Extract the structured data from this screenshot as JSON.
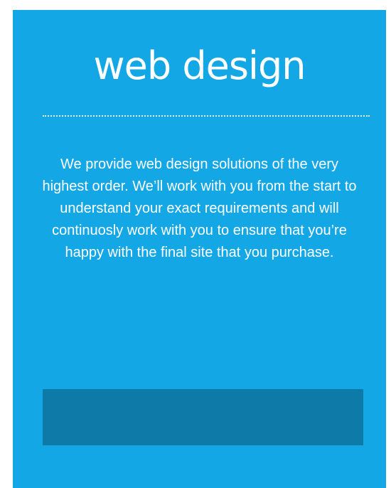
{
  "card": {
    "title": "web design",
    "description": "We provide web design solutions of the very highest order. We’ll work with you from the start to understand your exact requirements and will continuosly work with you to ensure that you’re happy with the final site that you purchase.",
    "button_label": ""
  },
  "colors": {
    "card_background": "#14a7e6",
    "button_background": "#0d7aa8",
    "text": "#ffffff"
  }
}
